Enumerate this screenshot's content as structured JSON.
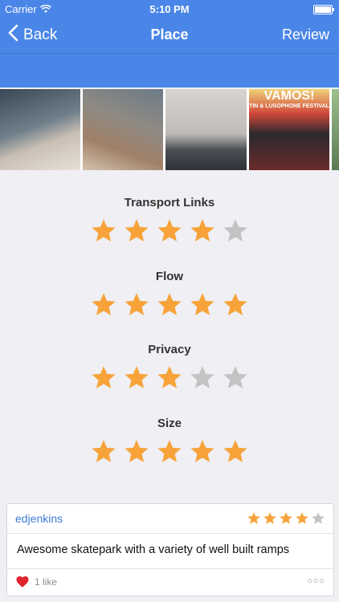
{
  "status": {
    "carrier": "Carrier",
    "time": "5:10 PM"
  },
  "nav": {
    "back_label": "Back",
    "title": "Place",
    "action_label": "Review",
    "color": "#4a86e8"
  },
  "photos": {
    "poster_headline": "VAMOS!",
    "poster_sub": "TIN & LUSOPHONE FESTIVAL"
  },
  "ratings": [
    {
      "label": "Transport Links",
      "value": 4,
      "max": 5
    },
    {
      "label": "Flow",
      "value": 5,
      "max": 5
    },
    {
      "label": "Privacy",
      "value": 3,
      "max": 5
    },
    {
      "label": "Size",
      "value": 5,
      "max": 5
    }
  ],
  "review": {
    "user": "edjenkins",
    "rating": 4,
    "max": 5,
    "text": "Awesome skatepark with a variety of well built ramps",
    "likes": "1 like",
    "more": "○○○"
  },
  "colors": {
    "star_on": "#f7a33a",
    "star_off": "#c3c3c3",
    "heart": "#e0242b"
  },
  "icons": {
    "back": "chevron-left-icon",
    "heart": "heart-icon",
    "star": "star-icon"
  }
}
